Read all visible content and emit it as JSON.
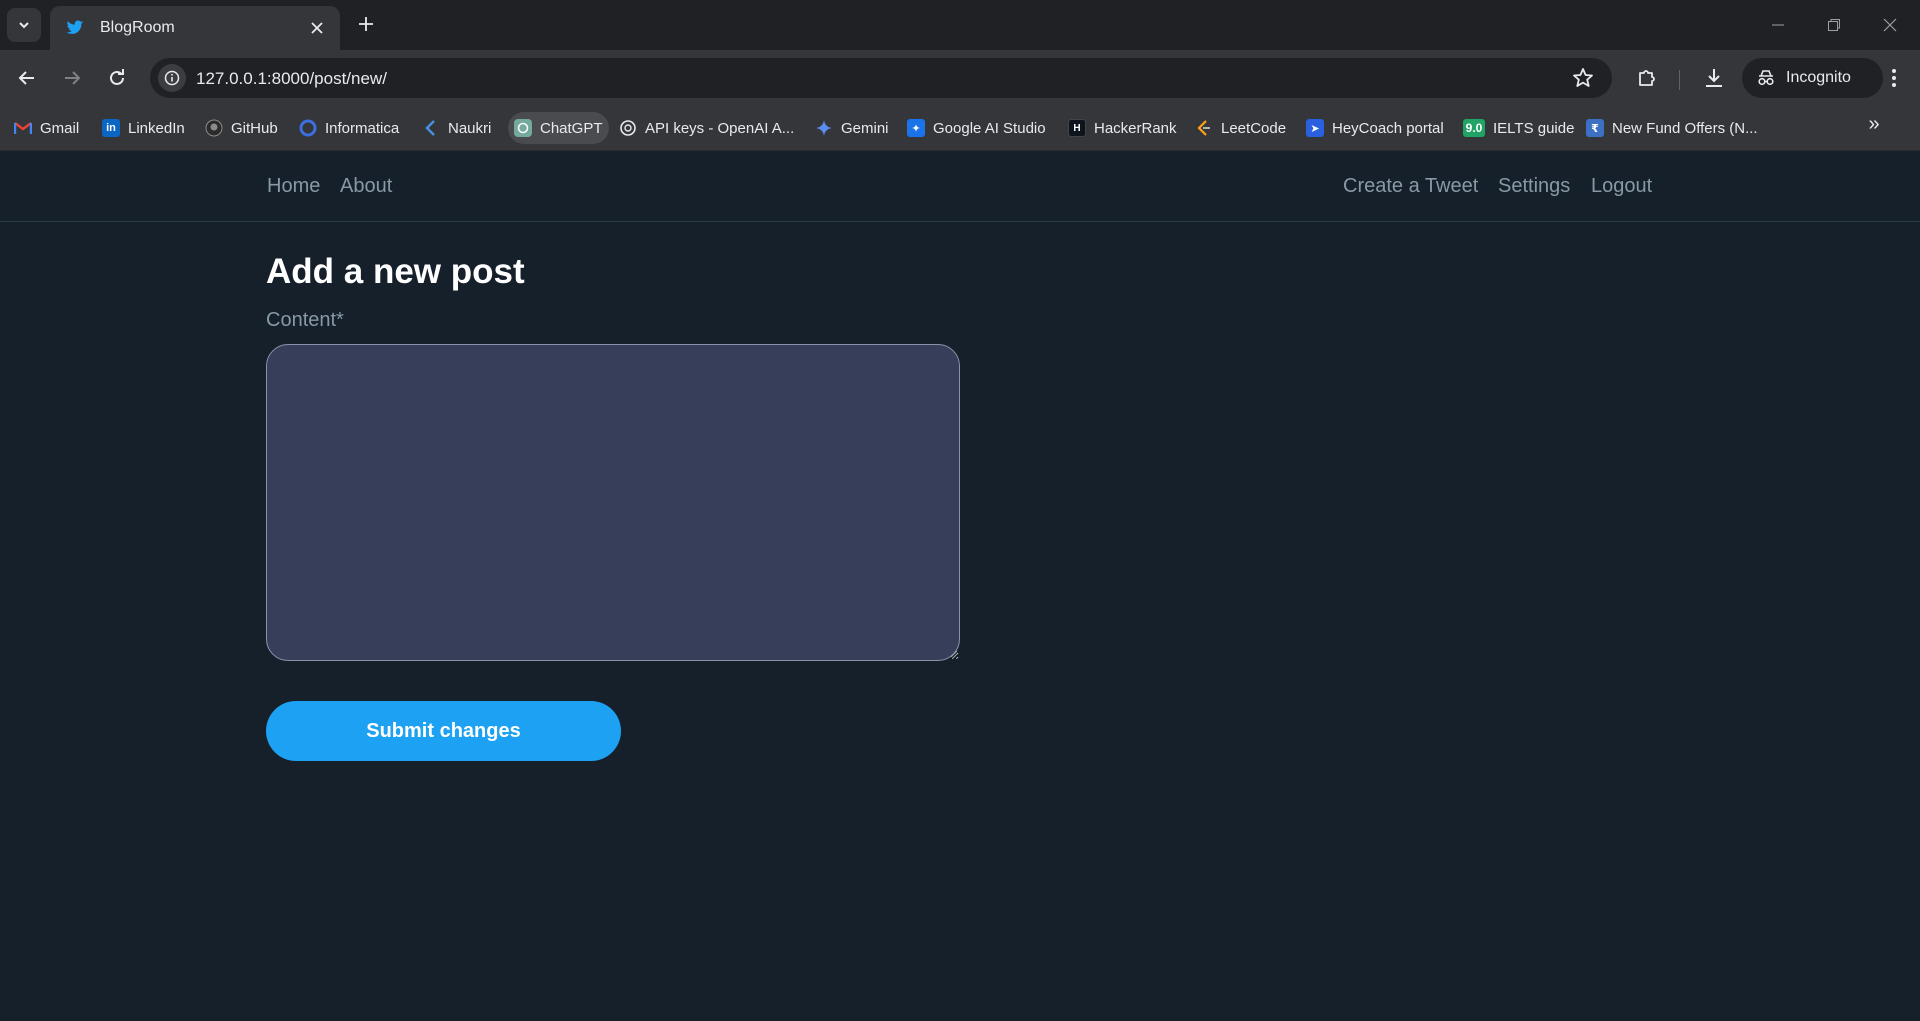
{
  "browser": {
    "tab_title": "BlogRoom",
    "url": "127.0.0.1:8000/post/new/",
    "profile_label": "Incognito",
    "bookmarks": [
      {
        "label": "Gmail",
        "icon": "gmail-icon"
      },
      {
        "label": "LinkedIn",
        "icon": "linkedin-icon"
      },
      {
        "label": "GitHub",
        "icon": "github-icon"
      },
      {
        "label": "Informatica",
        "icon": "informatica-icon"
      },
      {
        "label": "Naukri",
        "icon": "naukri-icon"
      },
      {
        "label": "ChatGPT",
        "icon": "chatgpt-icon"
      },
      {
        "label": "API keys - OpenAI A...",
        "icon": "openai-icon"
      },
      {
        "label": "Gemini",
        "icon": "gemini-icon"
      },
      {
        "label": "Google AI Studio",
        "icon": "google-ai-studio-icon"
      },
      {
        "label": "HackerRank",
        "icon": "hackerrank-icon"
      },
      {
        "label": "LeetCode",
        "icon": "leetcode-icon"
      },
      {
        "label": "HeyCoach portal",
        "icon": "heycoach-icon"
      },
      {
        "label": "IELTS guide",
        "icon": "ielts-icon",
        "badge": "9.0"
      },
      {
        "label": "New Fund Offers (N...",
        "icon": "fund-offers-icon"
      }
    ]
  },
  "site_nav": {
    "home": "Home",
    "about": "About",
    "create": "Create a Tweet",
    "settings": "Settings",
    "logout": "Logout"
  },
  "form": {
    "title": "Add a new post",
    "content_label": "Content*",
    "content_value": "",
    "submit_label": "Submit changes"
  },
  "colors": {
    "page_bg": "#15202b",
    "accent": "#1da1f2",
    "textarea_bg": "#373e5a",
    "muted_text": "#8899a6"
  }
}
